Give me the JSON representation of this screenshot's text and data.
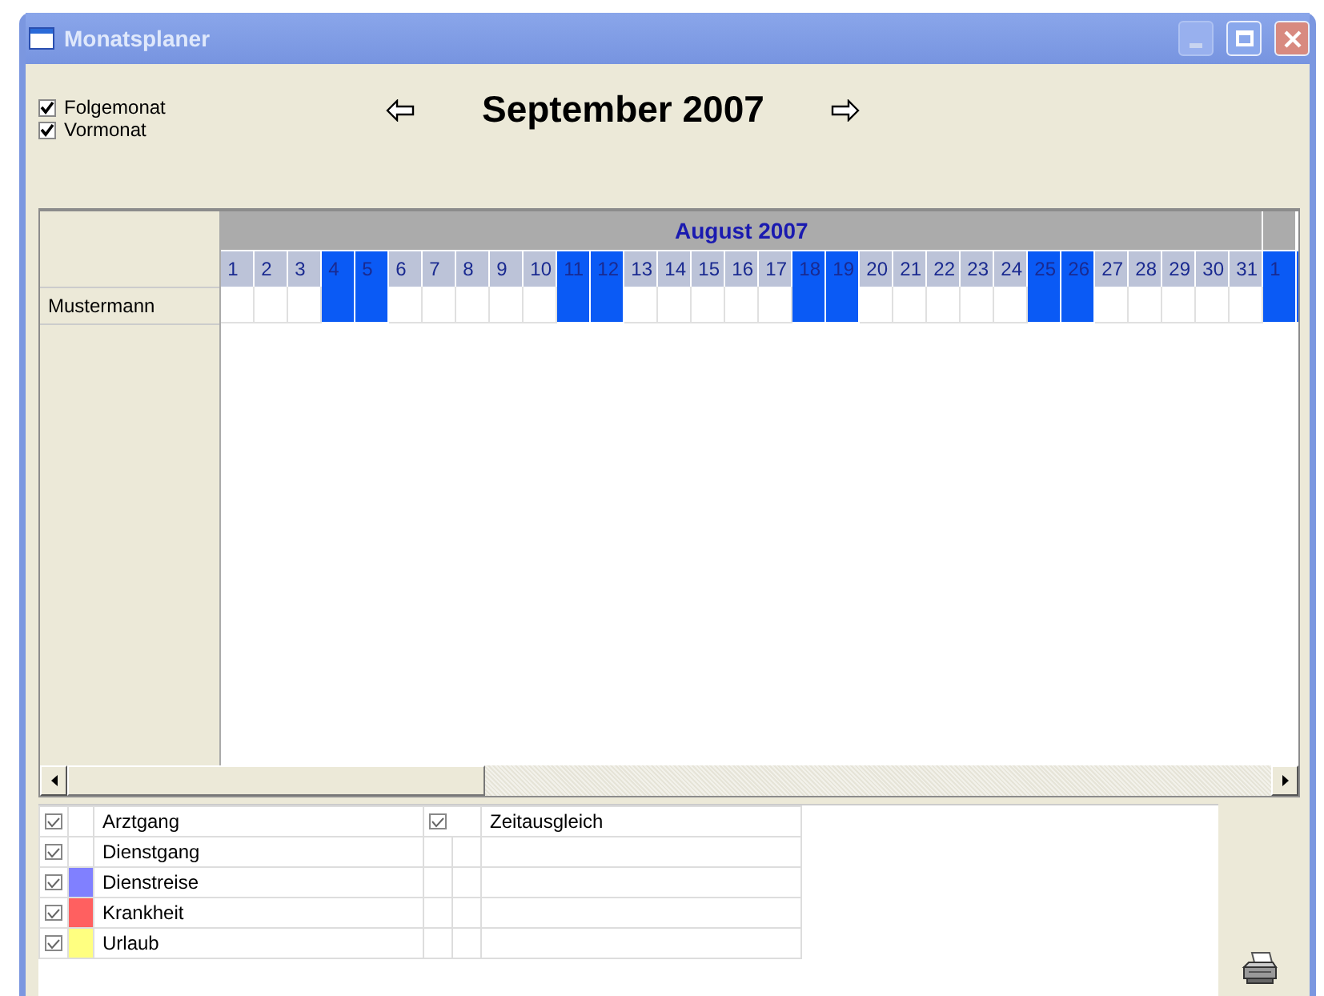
{
  "window": {
    "title": "Monatsplaner"
  },
  "options": [
    {
      "label": "Folgemonat",
      "checked": true
    },
    {
      "label": "Vormonat",
      "checked": true
    }
  ],
  "nav": {
    "title": "September 2007"
  },
  "calendar": {
    "months": [
      {
        "label": "August 2007",
        "days": [
          {
            "label": "1",
            "weekend": false
          },
          {
            "label": "2",
            "weekend": false
          },
          {
            "label": "3",
            "weekend": false
          },
          {
            "label": "4",
            "weekend": true
          },
          {
            "label": "5",
            "weekend": true
          },
          {
            "label": "6",
            "weekend": false
          },
          {
            "label": "7",
            "weekend": false
          },
          {
            "label": "8",
            "weekend": false
          },
          {
            "label": "9",
            "weekend": false
          },
          {
            "label": "10",
            "weekend": false
          },
          {
            "label": "11",
            "weekend": true
          },
          {
            "label": "12",
            "weekend": true
          },
          {
            "label": "13",
            "weekend": false
          },
          {
            "label": "14",
            "weekend": false
          },
          {
            "label": "15",
            "weekend": false
          },
          {
            "label": "16",
            "weekend": false
          },
          {
            "label": "17",
            "weekend": false
          },
          {
            "label": "18",
            "weekend": true
          },
          {
            "label": "19",
            "weekend": true
          },
          {
            "label": "20",
            "weekend": false
          },
          {
            "label": "21",
            "weekend": false
          },
          {
            "label": "22",
            "weekend": false
          },
          {
            "label": "23",
            "weekend": false
          },
          {
            "label": "24",
            "weekend": false
          },
          {
            "label": "25",
            "weekend": true
          },
          {
            "label": "26",
            "weekend": true
          },
          {
            "label": "27",
            "weekend": false
          },
          {
            "label": "28",
            "weekend": false
          },
          {
            "label": "29",
            "weekend": false
          },
          {
            "label": "30",
            "weekend": false
          },
          {
            "label": "31",
            "weekend": false
          }
        ]
      },
      {
        "days": [
          {
            "label": "1",
            "weekend": true
          }
        ]
      }
    ],
    "employees": [
      {
        "name": "Mustermann"
      }
    ]
  },
  "legend": {
    "left": [
      {
        "label": "Arztgang",
        "checked": true
      },
      {
        "label": "Dienstgang",
        "checked": true
      },
      {
        "label": "Dienstreise",
        "checked": true,
        "color": "#8080ff"
      },
      {
        "label": "Krankheit",
        "checked": true,
        "color": "#ff6060"
      },
      {
        "label": "Urlaub",
        "checked": true,
        "color": "#ffff80"
      }
    ],
    "right": [
      {
        "label": "Zeitausgleich",
        "checked": true
      }
    ]
  }
}
